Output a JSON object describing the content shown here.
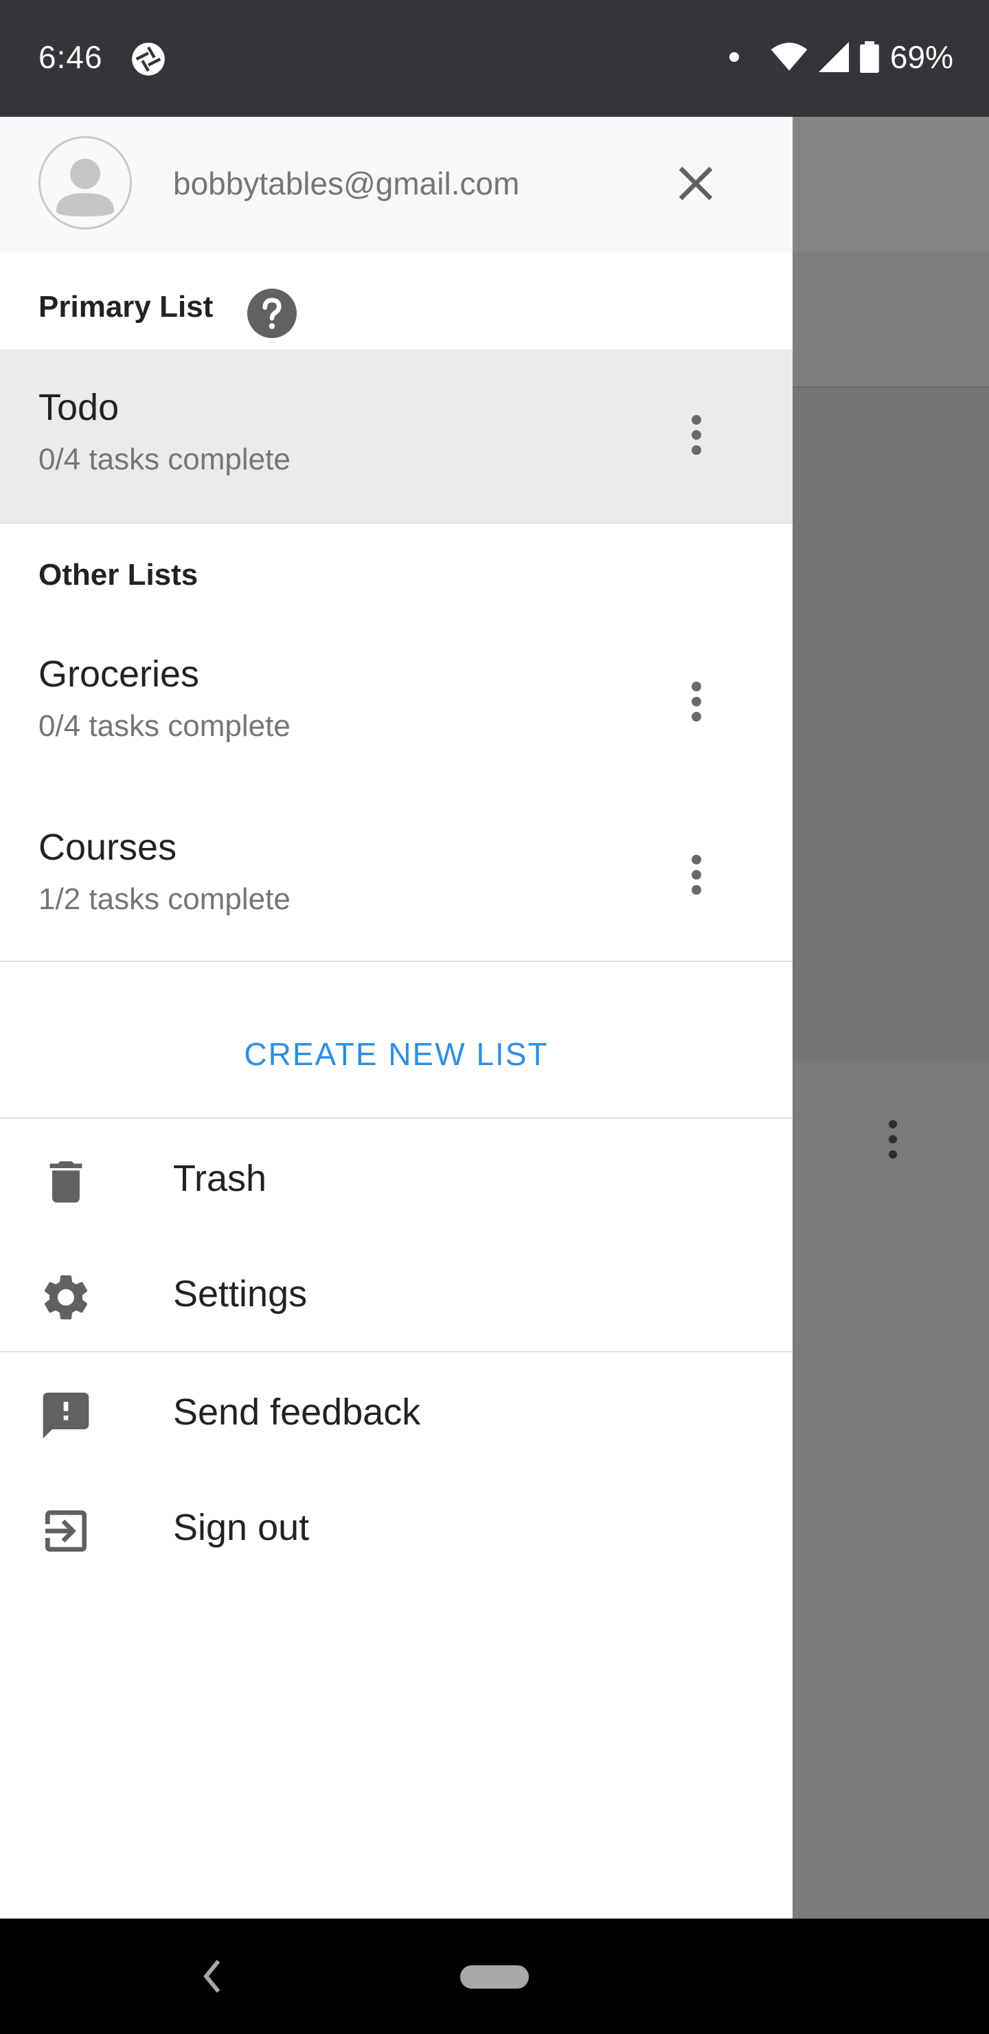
{
  "status_bar": {
    "time": "6:46",
    "battery": "69%"
  },
  "drawer": {
    "account": {
      "email": "bobbytables@gmail.com"
    },
    "primary_section_title": "Primary List",
    "primary_lists": [
      {
        "name": "Todo",
        "progress": "0/4 tasks complete"
      }
    ],
    "other_section_title": "Other Lists",
    "other_lists": [
      {
        "name": "Groceries",
        "progress": "0/4 tasks complete"
      },
      {
        "name": "Courses",
        "progress": "1/2 tasks complete"
      }
    ],
    "create_list_label": "CREATE NEW LIST",
    "menu": [
      {
        "label": "Trash",
        "icon": "trash-icon"
      },
      {
        "label": "Settings",
        "icon": "gear-icon"
      },
      {
        "label": "Send feedback",
        "icon": "feedback-icon"
      },
      {
        "label": "Sign out",
        "icon": "sign-out-icon"
      }
    ]
  },
  "colors": {
    "accent": "#2f8ee0",
    "selected_row": "#ebebeb",
    "scrim": "#7b7b7b",
    "status_bar": "#333538"
  }
}
